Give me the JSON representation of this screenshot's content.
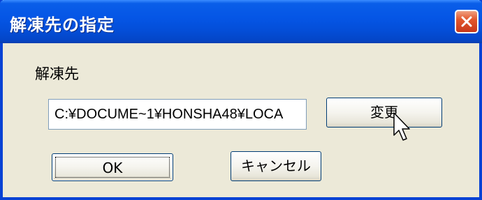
{
  "window": {
    "title": "解凍先の指定"
  },
  "destination": {
    "label": "解凍先",
    "path_value": "C:¥DOCUME~1¥HONSHA48¥LOCA"
  },
  "buttons": {
    "change_label": "変更",
    "ok_label": "OK",
    "cancel_label": "キャンセル"
  },
  "colors": {
    "titlebar": "#0556E6",
    "frame": "#0842D4",
    "dialog_bg": "#ECE9D8",
    "close_button": "#E2572C"
  },
  "icons": {
    "close": "close-icon",
    "cursor": "mouse-pointer-icon"
  }
}
